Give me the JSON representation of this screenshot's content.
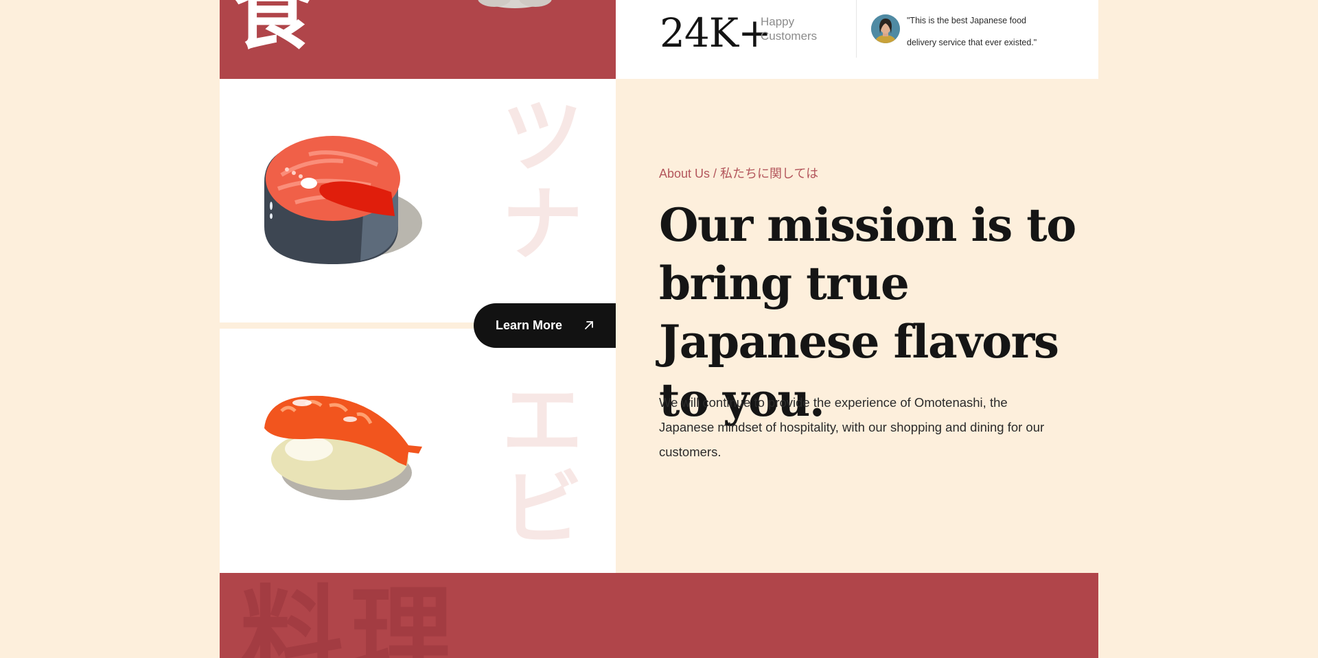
{
  "hero_decor": {
    "top_kanji": "食",
    "bottom_kanji": "料理"
  },
  "stats": {
    "number": "24K+",
    "label": "Happy Customers",
    "quote": "\"This is the best Japanese food delivery service that ever existed.\""
  },
  "gallery": {
    "tiles": [
      {
        "item": "tuna-steak",
        "kana": "ツナ"
      },
      {
        "item": "shrimp-nigiri",
        "kana": "エビ"
      }
    ],
    "cta_label": "Learn More"
  },
  "about": {
    "eyebrow": "About Us / 私たちに関しては",
    "heading": "Our mission is to bring true Japanese flavors to you.",
    "body": "We will continue to provide the experience of Omotenashi, the Japanese mindset of hospitality, with our shopping and dining for our customers."
  },
  "colors": {
    "brand_red": "#b0454a",
    "cream": "#fdefdc",
    "dark": "#121212",
    "eyebrow": "#b3565c"
  },
  "icons": {
    "cta_icon": "arrow-up-right-icon",
    "avatar": "customer-avatar"
  }
}
